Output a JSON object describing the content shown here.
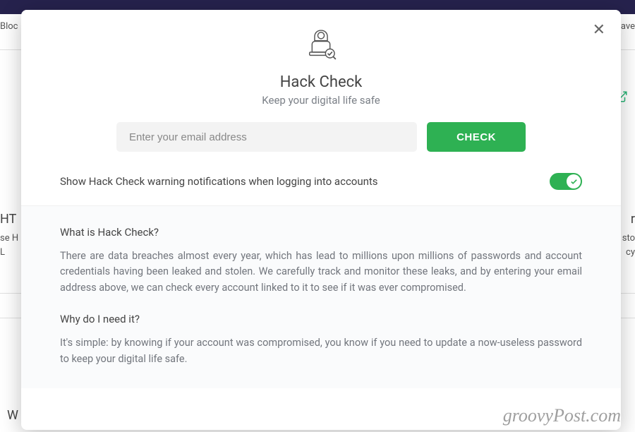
{
  "background": {
    "top_left": "Bloc",
    "top_right": "ave",
    "h_left": "HT",
    "seh_left": "se H",
    "l_left": "L",
    "r_right": "r",
    "sto_right": "sto",
    "cy_right": "cy",
    "w_bottom": "W"
  },
  "modal": {
    "title": "Hack Check",
    "subtitle": "Keep your digital life safe",
    "email_placeholder": "Enter your email address",
    "check_button": "CHECK",
    "toggle_label": "Show Hack Check warning notifications when logging into accounts",
    "toggle_on": true,
    "info": {
      "q1": "What is Hack Check?",
      "a1": "There are data breaches almost every year, which has lead to millions upon millions of passwords and account credentials having been leaked and stolen. We carefully track and monitor these leaks, and by entering your email address above, we can check every account linked to it to see if it was ever compromised.",
      "q2": "Why do I need it?",
      "a2": "It's simple: by knowing if your account was compromised, you know if you need to update a now-useless password to keep your digital life safe."
    }
  },
  "watermark": "groovyPost.com"
}
